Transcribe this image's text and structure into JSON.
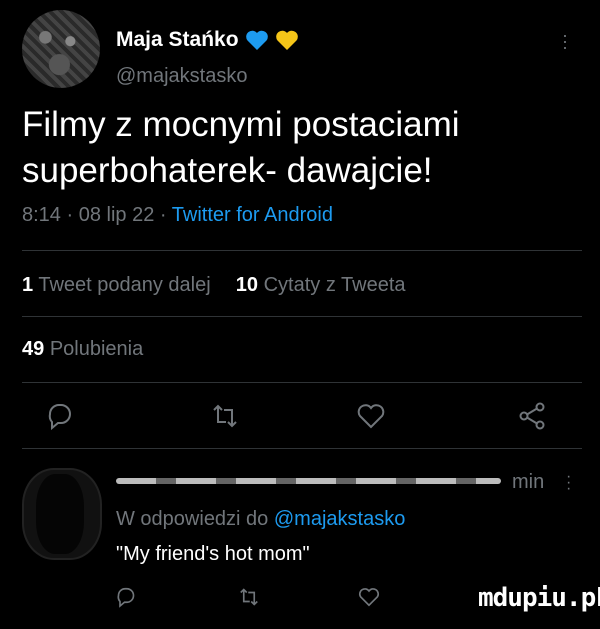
{
  "tweet": {
    "author_name": "Maja Stańko",
    "author_handle": "@majakstasko",
    "text": "Filmy z mocnymi postaciami superbohaterek- dawajcie!",
    "time": "8:14",
    "date": "08 lip 22",
    "source": "Twitter for Android",
    "separator": "·",
    "retweets_count": "1",
    "retweets_label": "Tweet podany dalej",
    "quotes_count": "10",
    "quotes_label": "Cytaty z Tweeta",
    "likes_count": "49",
    "likes_label": "Polubienia",
    "badges": [
      "blue-heart",
      "yellow-heart"
    ]
  },
  "reply": {
    "time": "min",
    "replying_prefix": "W odpowiedzi do",
    "replying_handle": "@majakstasko",
    "text": "\"My friend's hot mom\""
  },
  "watermark": "mdupiu.pL",
  "colors": {
    "background": "#000000",
    "text": "#e7e9ea",
    "muted": "#71767b",
    "accent": "#1d9bf0",
    "divider": "#2f3336",
    "heart_blue": "#1d9bf0",
    "heart_yellow": "#f5c518"
  }
}
